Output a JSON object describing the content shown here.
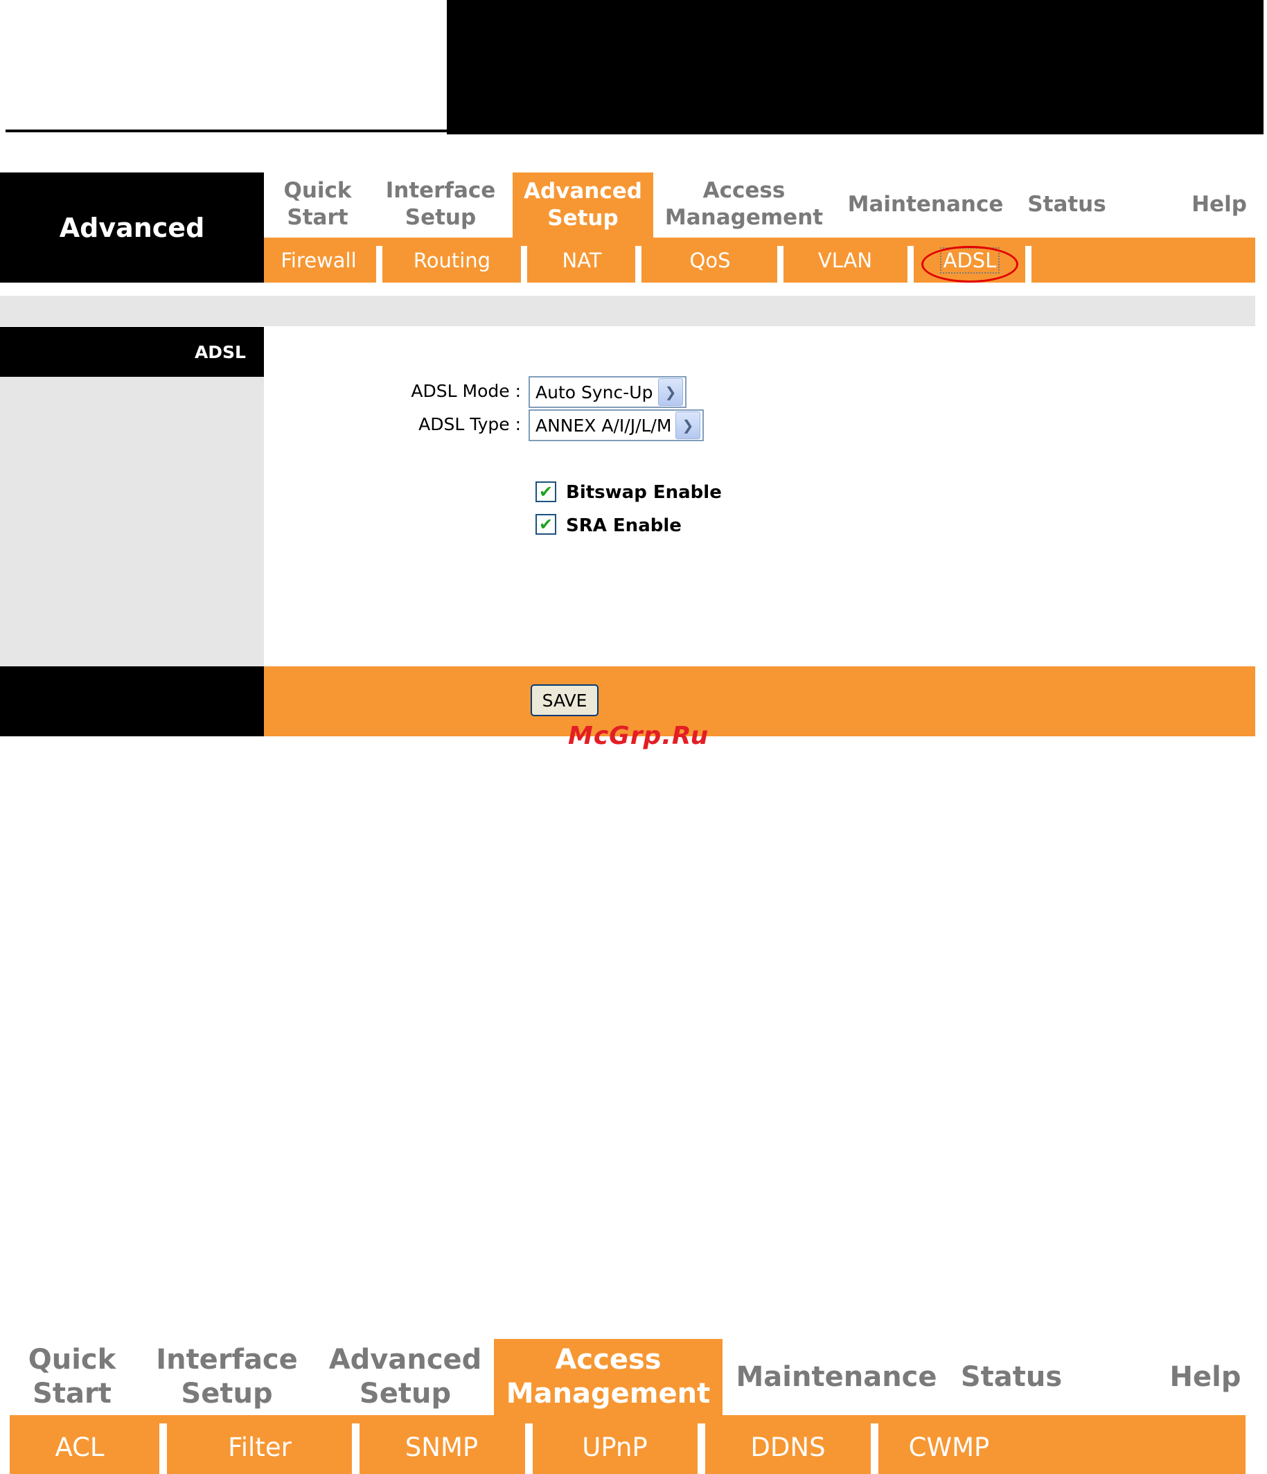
{
  "brand": "Advanced",
  "top_nav": [
    {
      "label": "Quick\nStart",
      "active": false
    },
    {
      "label": "Interface\nSetup",
      "active": false
    },
    {
      "label": "Advanced\nSetup",
      "active": true
    },
    {
      "label": "Access\nManagement",
      "active": false
    },
    {
      "label": "Maintenance",
      "active": false
    },
    {
      "label": "Status",
      "active": false
    },
    {
      "label": "Help",
      "active": false
    }
  ],
  "sub_nav": [
    "Firewall",
    "Routing",
    "NAT",
    "QoS",
    "VLAN",
    "ADSL"
  ],
  "sub_nav_selected": "ADSL",
  "section_title": "ADSL",
  "form": {
    "mode_label": "ADSL Mode :",
    "mode_value": "Auto Sync-Up",
    "type_label": "ADSL Type :",
    "type_value": "ANNEX A/I/J/L/M",
    "bitswap_label": "Bitswap Enable",
    "bitswap_checked": true,
    "sra_label": "SRA Enable",
    "sra_checked": true
  },
  "save_label": "SAVE",
  "watermark": "McGrp.Ru",
  "top_nav_2": [
    {
      "label": "Quick\nStart",
      "active": false
    },
    {
      "label": "Interface\nSetup",
      "active": false
    },
    {
      "label": "Advanced\nSetup",
      "active": false
    },
    {
      "label": "Access\nManagement",
      "active": true
    },
    {
      "label": "Maintenance",
      "active": false
    },
    {
      "label": "Status",
      "active": false
    },
    {
      "label": "Help",
      "active": false
    }
  ],
  "sub_nav_2": [
    "ACL",
    "Filter",
    "SNMP",
    "UPnP",
    "DDNS",
    "CWMP"
  ],
  "colors": {
    "accent": "#f79733",
    "header": "#000000",
    "panel": "#e6e6e6",
    "highlight_ring": "#e10000"
  }
}
